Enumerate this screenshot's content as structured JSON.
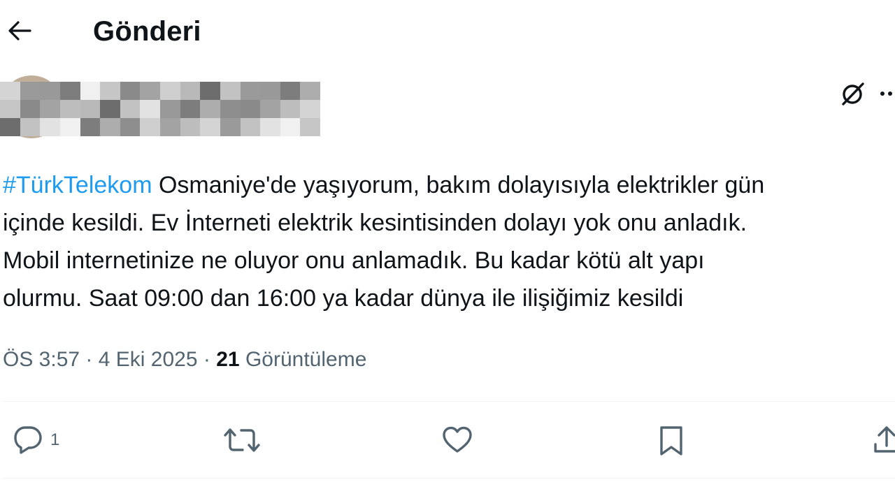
{
  "header": {
    "title": "Gönderi",
    "back_icon": "arrow-left-icon"
  },
  "post": {
    "hashtag": "#TürkTelekom",
    "text_line1": " Osmaniye'de yaşıyorum, bakım dolayısıyla elektrikler gün",
    "text_line2": "içinde kesildi. Ev İnterneti elektrik kesintisinden dolayı yok onu anladık.",
    "text_line3": "Mobil internetinize ne oluyor onu anlamadık. Bu kadar kötü alt yapı",
    "text_line4": "olurmu. Saat 09:00 dan 16:00 ya kadar dünya ile ilişiğimiz kesildi",
    "time": "ÖS 3:57",
    "date": "4 Eki 2025",
    "separator": "·",
    "views_count": "21",
    "views_label": "Görüntüleme"
  },
  "actions": {
    "reply_count": "1",
    "icons": [
      "reply-icon",
      "retweet-icon",
      "like-icon",
      "bookmark-icon",
      "share-icon"
    ]
  },
  "colors": {
    "accent": "#1d9bf0",
    "muted": "#536471",
    "text": "#0f1419"
  }
}
